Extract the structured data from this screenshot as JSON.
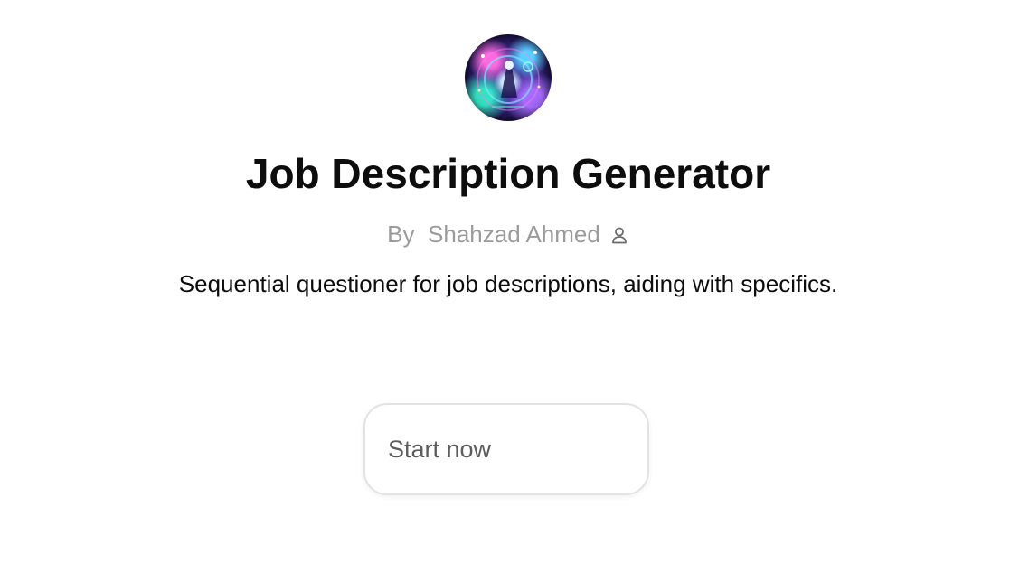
{
  "gpt": {
    "title": "Job Description Generator",
    "author_prefix": "By",
    "author_name": "Shahzad Ahmed",
    "description": "Sequential questioner for job descriptions, aiding with specifics."
  },
  "icons": {
    "avatar": "gpt-avatar-image",
    "author": "user-icon"
  },
  "actions": {
    "start_label": "Start now"
  },
  "colors": {
    "title": "#0d0d0d",
    "byline": "#9b9b9b",
    "button_border": "#e3e3e3",
    "button_text": "#5d5d5d"
  }
}
